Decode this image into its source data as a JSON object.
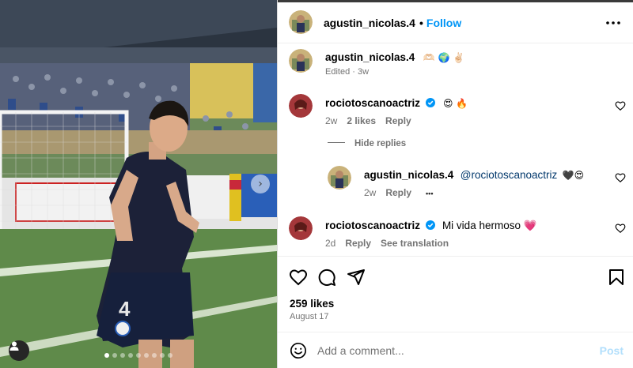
{
  "post": {
    "author": "agustin_nicolas.4",
    "follow_label": "Follow",
    "separator": "•",
    "caption": {
      "username": "agustin_nicolas.4",
      "emojis": "🫶🏻 🌍 ✌🏻",
      "meta": "Edited · 3w"
    },
    "likes": "259 likes",
    "date": "August 17"
  },
  "comments": [
    {
      "username": "rociotoscanoactriz",
      "verified": true,
      "text": "😍 🔥",
      "time": "2w",
      "likes": "2 likes",
      "reply_label": "Reply"
    },
    {
      "username": "rociotoscanoactriz",
      "verified": true,
      "text": "Mi vida hermoso 💗",
      "time": "2d",
      "reply_label": "Reply",
      "translation_label": "See translation"
    }
  ],
  "hide_replies_label": "Hide replies",
  "reply": {
    "username": "agustin_nicolas.4",
    "mention": "@rociotoscanoactriz",
    "text": "🖤😍",
    "time": "2w",
    "reply_label": "Reply",
    "more_label": "•••"
  },
  "comment_box": {
    "placeholder": "Add a comment...",
    "post_label": "Post"
  },
  "icons": {
    "more": "more-horizontal-icon",
    "like": "heart-icon",
    "comment": "comment-icon",
    "share": "share-icon",
    "save": "bookmark-icon",
    "emoji": "emoji-icon",
    "verified": "verified-badge-icon",
    "carousel_next": "chevron-right-icon",
    "tagged_user": "user-icon"
  },
  "colors": {
    "link": "#0095f6",
    "post_disabled": "#b2dffc",
    "verified": "#0095f6",
    "secondary_text": "#737373",
    "mention": "#00376b"
  },
  "carousel": {
    "slides": 9,
    "active_index": 0,
    "next_glyph": "›"
  }
}
